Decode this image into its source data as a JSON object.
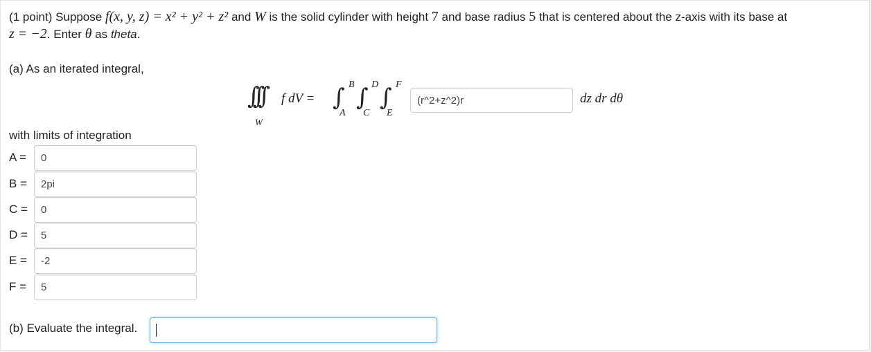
{
  "problem": {
    "prefix": "(1 point) Suppose ",
    "func": "f(x, y, z) = x² + y² + z²",
    "and": " and ",
    "W": "W",
    "desc": " is the solid cylinder with height ",
    "height": "7",
    "desc2": " and base radius ",
    "radius": "5",
    "desc3": " that is centered about the z-axis with its base at",
    "base_eq": "z = −2",
    "enter_a": ". Enter ",
    "theta": "θ",
    "enter_b": " as ",
    "theta_word": "theta",
    "period": "."
  },
  "part_a": {
    "label": "(a) As an iterated integral,",
    "lhs": "f dV =",
    "triple_sub": "W",
    "limits_upper": [
      "B",
      "D",
      "F"
    ],
    "limits_lower": [
      "A",
      "C",
      "E"
    ],
    "integrand_value": "(r^2+z^2)r",
    "differentials": "dz dr dθ",
    "limits_label": "with limits of integration",
    "limits": [
      {
        "label": "A =",
        "value": "0"
      },
      {
        "label": "B =",
        "value": "2pi"
      },
      {
        "label": "C =",
        "value": "0"
      },
      {
        "label": "D =",
        "value": "5"
      },
      {
        "label": "E =",
        "value": "-2"
      },
      {
        "label": "F =",
        "value": "5"
      }
    ]
  },
  "part_b": {
    "label": "(b) Evaluate the integral.",
    "value": ""
  }
}
